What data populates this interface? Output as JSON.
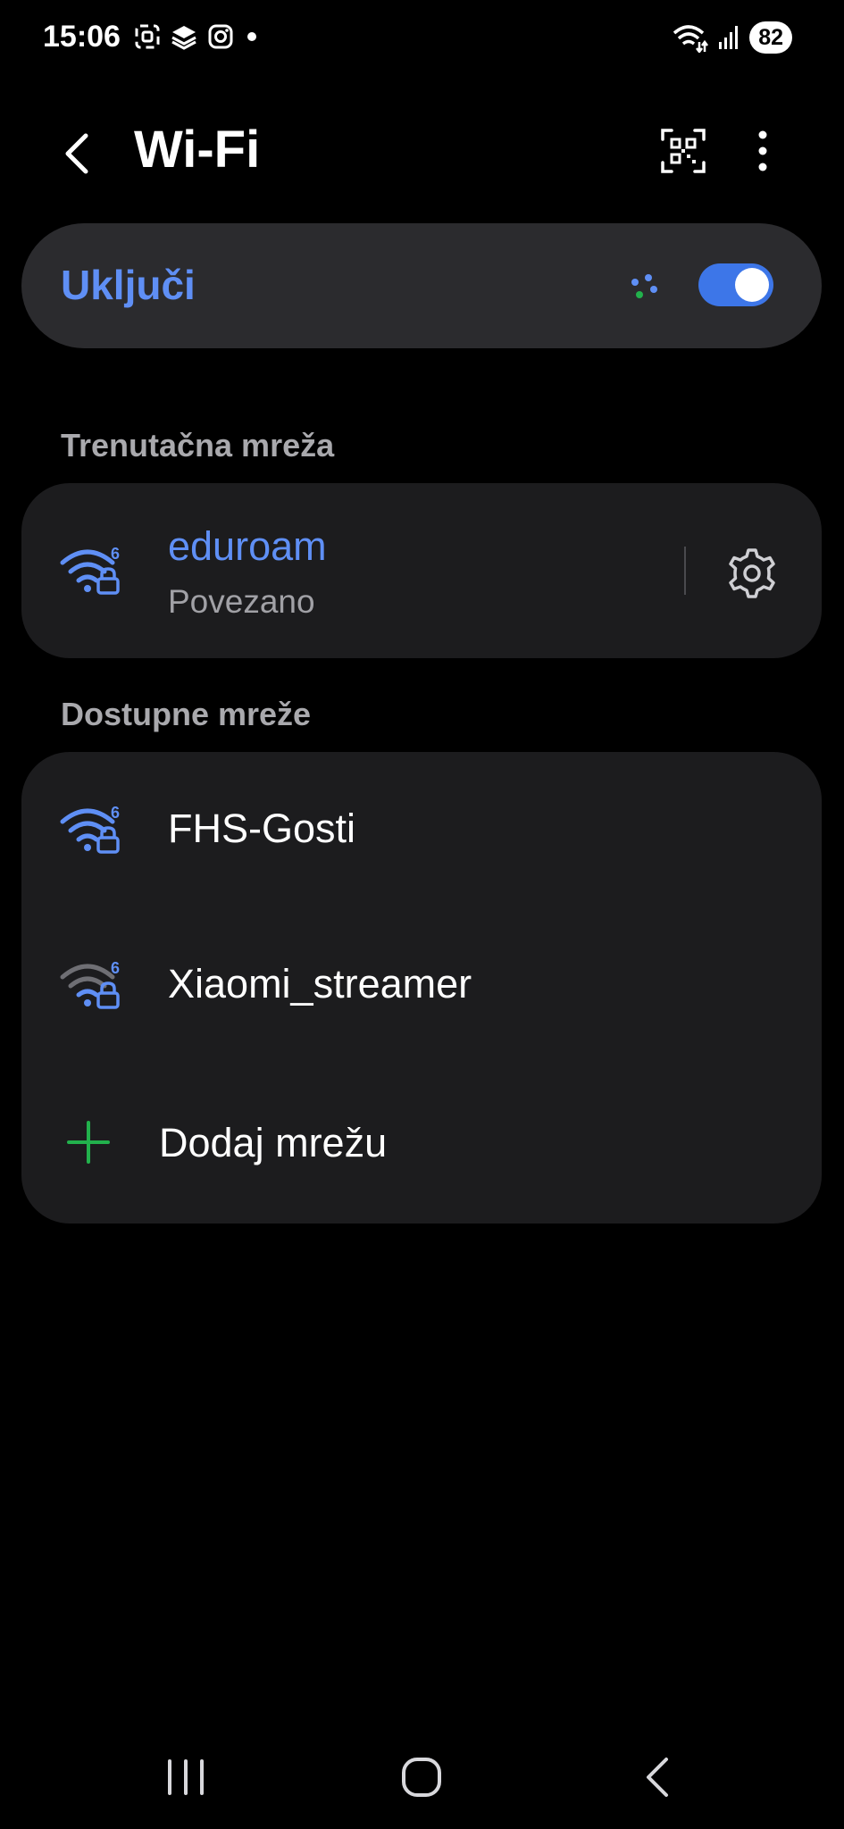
{
  "status_bar": {
    "time": "15:06",
    "battery": "82",
    "left_icons": [
      "screenshot-icon",
      "app-icon",
      "instagram-icon",
      "dot-icon"
    ],
    "right_icons": [
      "wifi-signal-icon",
      "cell-signal-icon"
    ]
  },
  "header": {
    "title": "Wi-Fi",
    "back_icon": "chevron-left-icon",
    "qr_icon": "qr-code-icon",
    "more_icon": "more-vertical-icon"
  },
  "wifi_toggle": {
    "label": "Uključi",
    "enabled": true
  },
  "current_network": {
    "heading": "Trenutačna mreža",
    "name": "eduroam",
    "status": "Povezano",
    "settings_icon": "gear-icon"
  },
  "available_networks": {
    "heading": "Dostupne mreže",
    "networks": [
      {
        "name": "FHS-Gosti",
        "signal": "strong"
      },
      {
        "name": "Xiaomi_streamer",
        "signal": "weak"
      }
    ],
    "add_label": "Dodaj mrežu"
  },
  "colors": {
    "accent": "#5f8ff5",
    "toggle_on": "#3d76e8",
    "add_icon": "#22b14c",
    "card": "#1c1c1e",
    "background": "#000000"
  },
  "nav_bar": {
    "icons": [
      "recent-apps-icon",
      "home-icon",
      "back-icon"
    ]
  }
}
